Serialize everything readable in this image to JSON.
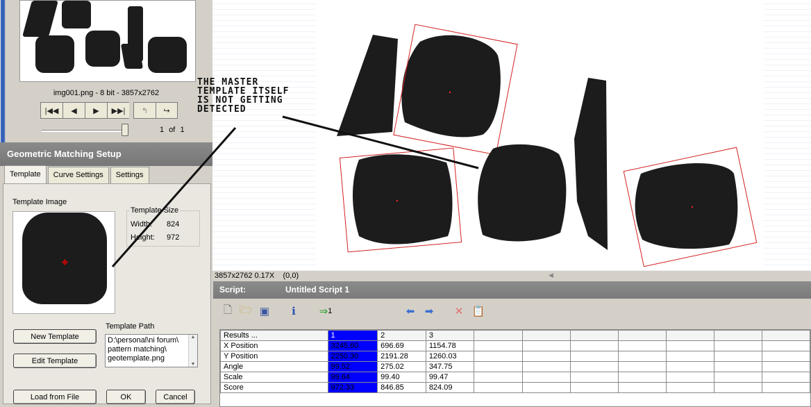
{
  "thumbnail": {
    "info": "img001.png - 8 bit - 3857x2762",
    "page_current": "1",
    "page_of": "of",
    "page_total": "1"
  },
  "setup": {
    "title": "Geometric Matching Setup",
    "tabs": [
      "Template",
      "Curve Settings",
      "Settings"
    ],
    "template_image_label": "Template Image",
    "template_size_label": "Template Size",
    "width_label": "Width:",
    "width_value": "824",
    "height_label": "Height:",
    "height_value": "972",
    "template_path_label": "Template Path",
    "template_path": [
      "D:\\personal\\ni forum\\",
      "pattern matching\\",
      "geotemplate.png"
    ],
    "new_template_btn": "New Template",
    "edit_template_btn": "Edit Template",
    "load_file_btn": "Load from File",
    "ok_btn": "OK",
    "cancel_btn": "Cancel"
  },
  "annotation": {
    "lines": [
      "THE MASTER",
      "TEMPLATE ITSELF",
      "IS NOT GETTING",
      "DETECTED"
    ]
  },
  "view": {
    "status_size": "3857x2762 0.17X",
    "status_coord": "(0,0)"
  },
  "script": {
    "label": "Script:",
    "name": "Untitled Script 1"
  },
  "results": {
    "header": [
      "Results ...",
      "1",
      "2",
      "3"
    ],
    "rows": [
      {
        "label": "X Position",
        "values": [
          "3245.60",
          "696.69",
          "1154.78"
        ]
      },
      {
        "label": "Y Position",
        "values": [
          "2250.30",
          "2191.28",
          "1260.03"
        ]
      },
      {
        "label": "Angle",
        "values": [
          "99.52",
          "275.02",
          "347.75"
        ]
      },
      {
        "label": "Scale",
        "values": [
          "99.64",
          "99.40",
          "99.47"
        ]
      },
      {
        "label": "Score",
        "values": [
          "972.33",
          "846.85",
          "824.09"
        ]
      }
    ]
  },
  "colors": {
    "selected_column": "#0000ff",
    "match_box": "#d42020",
    "panel_header": "#808080"
  }
}
